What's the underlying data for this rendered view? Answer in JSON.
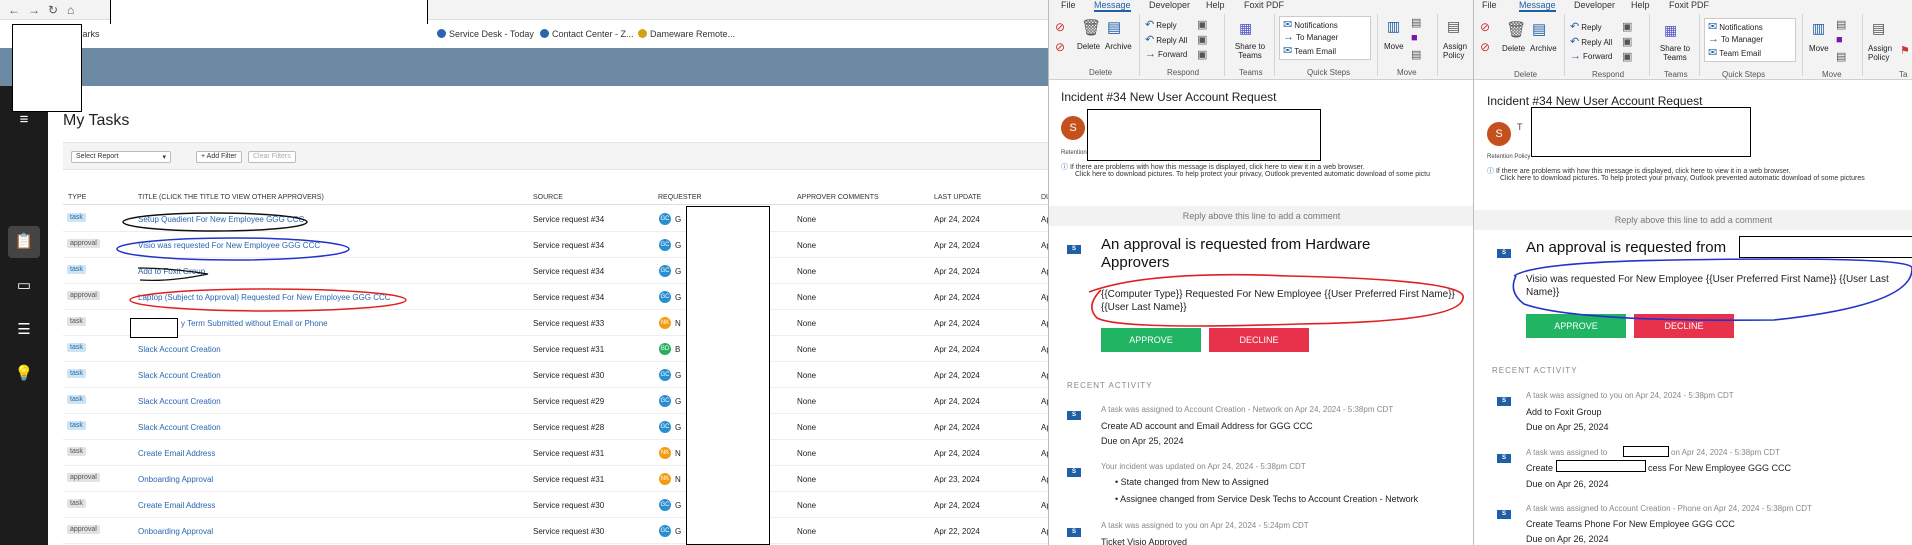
{
  "browser": {
    "bookmarks": [
      {
        "label": "Service Desk - Today",
        "color": "#2a66b0"
      },
      {
        "label": "Contact Center - Z...",
        "color": "#2a66b0"
      },
      {
        "label": "Dameware Remote...",
        "color": "#d4a017"
      }
    ],
    "bookmarks_label_fragment": "marks"
  },
  "tasks": {
    "title": "My Tasks",
    "select_report": "Select Report",
    "add_filter": "+ Add Filter",
    "clear_filters": "Clear Filters",
    "columns": [
      "TYPE",
      "TITLE (CLICK THE TITLE TO VIEW OTHER APPROVERS)",
      "SOURCE",
      "REQUESTER",
      "APPROVER COMMENTS",
      "LAST UPDATE",
      "DU"
    ],
    "rows": [
      {
        "type": "task",
        "title": "Setup Quadient For New Employee GGG CCC",
        "source": "Service request #34",
        "initials": "GC",
        "req": "G",
        "comments": "None",
        "updated": "Apr 24, 2024",
        "due": "Ap"
      },
      {
        "type": "approval",
        "title": "Visio was requested For New Employee GGG CCC",
        "source": "Service request #34",
        "initials": "GC",
        "req": "G",
        "comments": "None",
        "updated": "Apr 24, 2024",
        "due": "Ap"
      },
      {
        "type": "task",
        "title": "Add to Foxit Group",
        "source": "Service request #34",
        "initials": "GC",
        "req": "G",
        "comments": "None",
        "updated": "Apr 24, 2024",
        "due": "Ap"
      },
      {
        "type": "approval",
        "title": "Laptop (Subject to Approval) Requested For New Employee GGG CCC",
        "source": "Service request #34",
        "initials": "GC",
        "req": "G",
        "comments": "None",
        "updated": "Apr 24, 2024",
        "due": "Ap"
      },
      {
        "type": "task",
        "title": "y Term Submitted without Email or Phone",
        "source": "Service request #33",
        "initials": "NK",
        "req": "N",
        "comments": "None",
        "updated": "Apr 24, 2024",
        "due": "Ap"
      },
      {
        "type": "task",
        "title": "Slack Account Creation",
        "source": "Service request #31",
        "initials": "BD",
        "req": "B",
        "comments": "None",
        "updated": "Apr 24, 2024",
        "due": "Ap"
      },
      {
        "type": "task",
        "title": "Slack Account Creation",
        "source": "Service request #30",
        "initials": "GC",
        "req": "G",
        "comments": "None",
        "updated": "Apr 24, 2024",
        "due": "Ap"
      },
      {
        "type": "task",
        "title": "Slack Account Creation",
        "source": "Service request #29",
        "initials": "GC",
        "req": "G",
        "comments": "None",
        "updated": "Apr 24, 2024",
        "due": "Ap"
      },
      {
        "type": "task",
        "title": "Slack Account Creation",
        "source": "Service request #28",
        "initials": "GC",
        "req": "G",
        "comments": "None",
        "updated": "Apr 24, 2024",
        "due": "Ap"
      },
      {
        "type": "task",
        "title": "Create Email Address",
        "source": "Service request #31",
        "initials": "NK",
        "req": "N",
        "comments": "None",
        "updated": "Apr 24, 2024",
        "due": "Ap"
      },
      {
        "type": "approval",
        "title": "Onboarding Approval",
        "source": "Service request #31",
        "initials": "NK",
        "req": "N",
        "comments": "None",
        "updated": "Apr 23, 2024",
        "due": "Ap"
      },
      {
        "type": "task",
        "title": "Create Email Address",
        "source": "Service request #30",
        "initials": "GC",
        "req": "G",
        "comments": "None",
        "updated": "Apr 24, 2024",
        "due": "Ap"
      },
      {
        "type": "approval",
        "title": "Onboarding Approval",
        "source": "Service request #30",
        "initials": "GC",
        "req": "G",
        "comments": "None",
        "updated": "Apr 22, 2024",
        "due": "Ap"
      }
    ]
  },
  "outlook": {
    "tabs": [
      "File",
      "Message",
      "Developer",
      "Help",
      "Foxit PDF"
    ],
    "delete": "Delete",
    "archive": "Archive",
    "reply": "Reply",
    "reply_all": "Reply All",
    "forward": "Forward",
    "share_teams": "Share to Teams",
    "qs_notifications": "Notifications",
    "qs_to_manager": "To Manager",
    "qs_team_email": "Team Email",
    "move": "Move",
    "assign_policy": "Assign Policy",
    "groups": [
      "Delete",
      "Respond",
      "Teams",
      "Quick Steps",
      "Move",
      "Ta"
    ],
    "subject": "Incident #34 New User Account Request",
    "sender_initial": "S",
    "retention": "Retention Po",
    "retention_b": "Retention Policy",
    "info1": "If there are problems with how this message is displayed, click here to view it in a web browser.",
    "info2a": "Click here to download pictures. To help protect your privacy, Outlook prevented automatic download of some pictu",
    "info2b": "Click here to download pictures. To help protect your privacy, Outlook prevented automatic download of some pictures",
    "reply_above": "Reply above this line to add a comment",
    "badge": "S",
    "approve": "APPROVE",
    "decline": "DECLINE",
    "recent_activity": "RECENT ACTIVITY",
    "panelA": {
      "heading": "An approval is requested from Hardware Approvers",
      "body": "{{Computer Type}} Requested For New Employee {{User Preferred First Name}} {{User Last Name}}",
      "activities": [
        {
          "meta": "A task was assigned to Account Creation - Network on Apr 24, 2024 - 5:38pm CDT",
          "lines": [
            "Create AD account and Email Address for GGG CCC",
            "Due on Apr 25, 2024"
          ]
        },
        {
          "meta": "Your incident was updated on Apr 24, 2024 - 5:38pm CDT",
          "lines": [
            "State changed from New to Assigned",
            "Assignee changed from Service Desk Techs to Account Creation - Network"
          ]
        },
        {
          "meta": "A task was assigned to you on Apr 24, 2024 - 5:24pm CDT",
          "lines": [
            "Ticket Visio Approved"
          ]
        }
      ]
    },
    "panelB": {
      "heading": "An approval is requested from",
      "body": "Visio was requested For New Employee {{User Preferred First Name}} {{User Last Name}}",
      "sender_fragment": "T",
      "activities": [
        {
          "meta": "A task was assigned to you on Apr 24, 2024 - 5:38pm CDT",
          "lines": [
            "Add to Foxit Group",
            "Due on Apr 25, 2024"
          ]
        },
        {
          "meta": "A task was assigned to",
          "meta2": "on Apr 24, 2024 - 5:38pm CDT",
          "lines": [
            "Create",
            "cess For New Employee GGG CCC",
            "Due on Apr 26, 2024"
          ]
        },
        {
          "meta": "A task was assigned to Account Creation - Phone on Apr 24, 2024 - 5:38pm CDT",
          "lines": [
            "Create Teams Phone For New Employee GGG CCC",
            "Due on Apr 26, 2024"
          ]
        }
      ]
    }
  },
  "colors": {
    "annotation_red": "#e0201f",
    "annotation_blue": "#2233cc",
    "accent": "#1f5fa6"
  }
}
